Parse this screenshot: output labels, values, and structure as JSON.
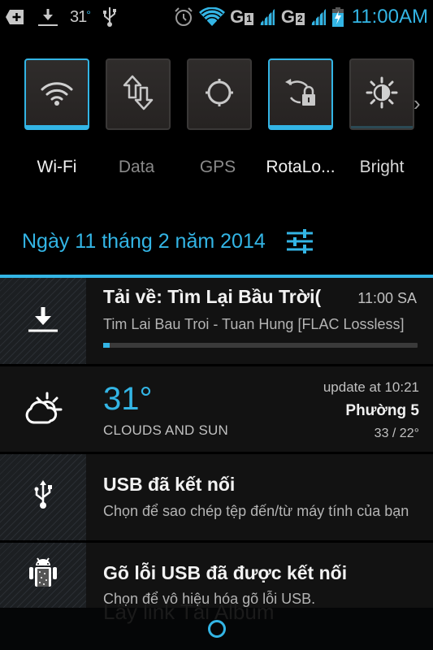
{
  "status_bar": {
    "left_icons": [
      "add-icon",
      "download-icon",
      "weather-temp",
      "usb-icon"
    ],
    "temperature": "31",
    "temperature_unit": "°",
    "right_icons": [
      "alarm-icon",
      "wifi-icon",
      "sim1-signal",
      "sim2-signal",
      "battery-charging-icon"
    ],
    "sim1_letter": "G",
    "sim1_number": "1",
    "sim2_letter": "G",
    "sim2_number": "2",
    "time": "11:00AM",
    "accent_color": "#33b5e5"
  },
  "quick_settings": {
    "tiles": [
      {
        "label": "Wi-Fi",
        "icon": "wifi-icon",
        "active": true
      },
      {
        "label": "Data",
        "icon": "data-transfer-icon",
        "active": false
      },
      {
        "label": "GPS",
        "icon": "gps-icon",
        "active": false
      },
      {
        "label": "RotaLo...",
        "icon": "rotation-lock-icon",
        "active": true
      },
      {
        "label": "Bright",
        "icon": "brightness-icon",
        "active": false
      }
    ],
    "more_icon": "chevron-right-icon"
  },
  "date_row": {
    "date": "Ngày 11 tháng 2 năm 2014",
    "settings_icon": "settings-sliders-icon"
  },
  "notifications": {
    "download": {
      "icon": "download-icon",
      "title": "Tải về: Tìm Lại Bầu Trời(",
      "time": "11:00 SA",
      "subtitle": "Tim Lai Bau Troi - Tuan Hung [FLAC Lossless]",
      "progress_percent": 1
    },
    "weather": {
      "icon": "cloud-sun-icon",
      "temperature": "31°",
      "condition": "CLOUDS AND SUN",
      "update_text": "update at 10:21",
      "location": "Phường 5",
      "high_low": "33 / 22°"
    },
    "usb": {
      "icon": "usb-icon",
      "title": "USB đã kết nối",
      "subtitle": "Chọn để sao chép tệp đến/từ máy tính của bạn"
    },
    "usb_debug": {
      "icon": "android-debug-icon",
      "title": "Gõ lỗi USB đã được kết nối",
      "subtitle": "Chọn để vô hiệu hóa gõ lỗi USB."
    }
  },
  "background_app": {
    "text": "Lấy link    Tải Album"
  }
}
